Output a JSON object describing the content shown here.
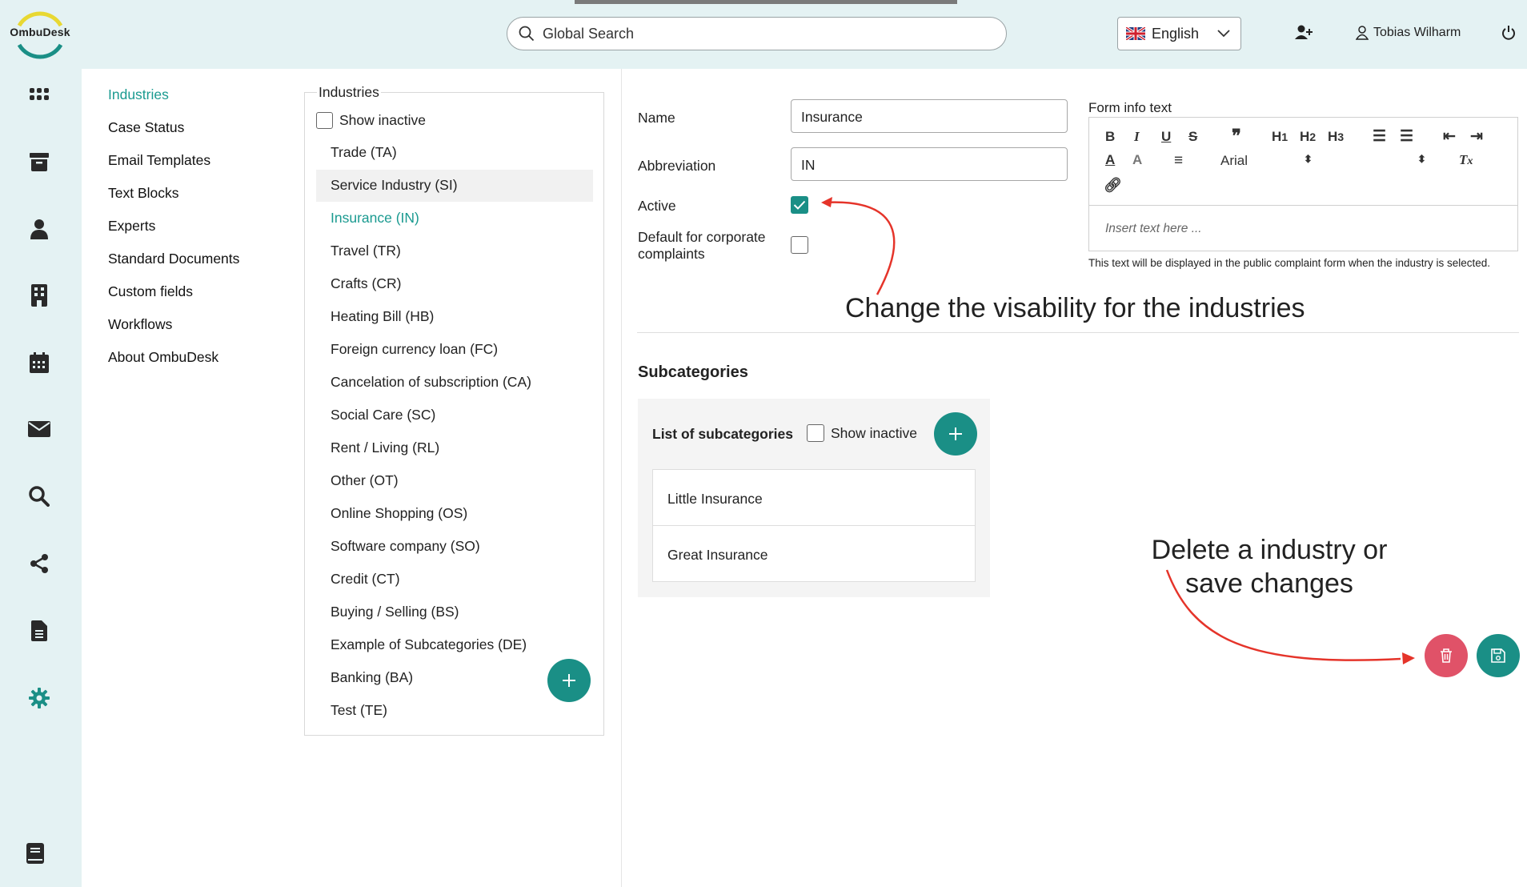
{
  "app": {
    "logo_text": "OmbuDesk"
  },
  "header": {
    "search_placeholder": "Global Search",
    "language": "English",
    "user_name": "Tobias Wilharm"
  },
  "settings_menu": {
    "items": [
      {
        "label": "Industries",
        "active": true
      },
      {
        "label": "Case Status"
      },
      {
        "label": "Email Templates"
      },
      {
        "label": "Text Blocks"
      },
      {
        "label": "Experts"
      },
      {
        "label": "Standard Documents"
      },
      {
        "label": "Custom fields"
      },
      {
        "label": "Workflows"
      },
      {
        "label": "About OmbuDesk"
      }
    ]
  },
  "industries": {
    "title": "Industries",
    "show_inactive_label": "Show inactive",
    "items": [
      "Trade (TA)",
      "Service Industry (SI)",
      "Insurance (IN)",
      "Travel (TR)",
      "Crafts (CR)",
      "Heating Bill (HB)",
      "Foreign currency loan (FC)",
      "Cancelation of subscription (CA)",
      "Social Care (SC)",
      "Rent / Living (RL)",
      "Other (OT)",
      "Online Shopping (OS)",
      "Software company (SO)",
      "Credit (CT)",
      "Buying / Selling (BS)",
      "Example of Subcategories (DE)",
      "Banking (BA)",
      "Test (TE)"
    ],
    "hover_index": 1,
    "selected_index": 2
  },
  "form": {
    "name_label": "Name",
    "name_value": "Insurance",
    "abbreviation_label": "Abbreviation",
    "abbreviation_value": "IN",
    "active_label": "Active",
    "active_checked": true,
    "default_label_line1": "Default for corporate",
    "default_label_line2": "complaints",
    "default_checked": false,
    "info_text_label": "Form info text",
    "editor_font": "Arial",
    "editor_placeholder": "Insert text here ...",
    "hint": "This text will be displayed in the public complaint form when the industry is selected."
  },
  "subcategories": {
    "title": "Subcategories",
    "list_title": "List of subcategories",
    "show_inactive_label": "Show inactive",
    "items": [
      "Little Insurance",
      "Great Insurance"
    ]
  },
  "annotations": {
    "visibility": "Change the visability for the industries",
    "delete_line1": "Delete a industry or",
    "delete_line2": "save changes"
  },
  "colors": {
    "accent": "#1a8f86",
    "active_link": "#1a9a90",
    "delete": "#e05268",
    "header_bg": "#e4f2f3",
    "annotation_arrow": "#e5342a"
  }
}
